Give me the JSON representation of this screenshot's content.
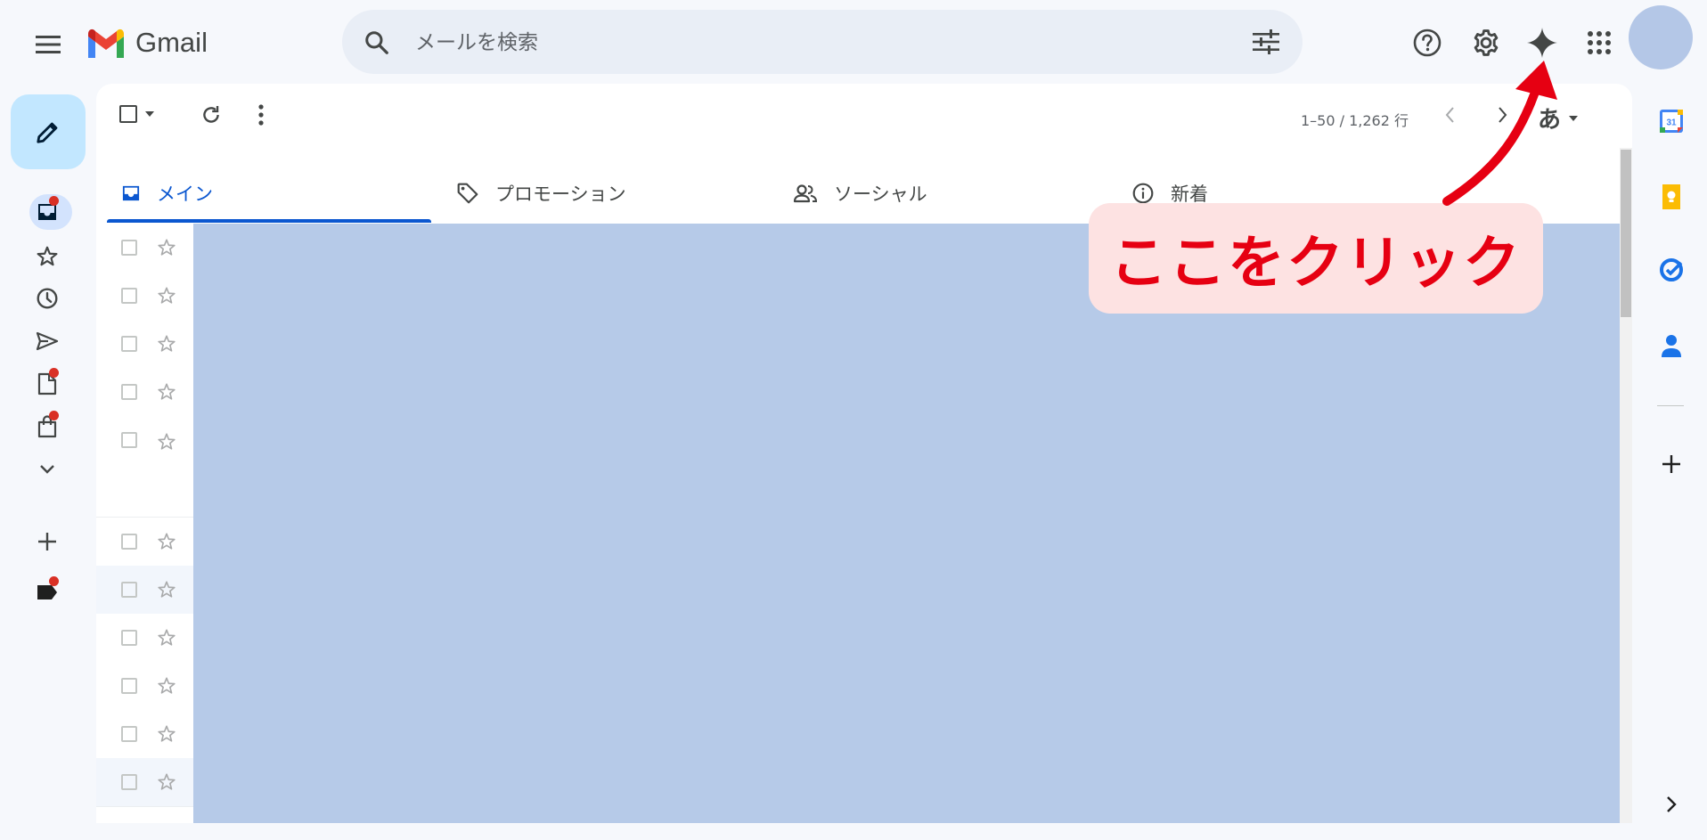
{
  "app": {
    "name": "Gmail"
  },
  "header": {
    "search_placeholder": "メールを検索"
  },
  "toolbar": {
    "pagination": "1–50 / 1,262 行",
    "input_tool_label": "あ"
  },
  "tabs": [
    {
      "label": "メイン",
      "icon": "inbox-icon",
      "selected": true
    },
    {
      "label": "プロモーション",
      "icon": "tag-icon",
      "selected": false
    },
    {
      "label": "ソーシャル",
      "icon": "people-icon",
      "selected": false
    },
    {
      "label": "新着",
      "icon": "info-icon",
      "selected": false
    }
  ],
  "left_nav": [
    {
      "icon": "inbox-icon",
      "active": true,
      "badge": true
    },
    {
      "icon": "star-icon",
      "badge": false
    },
    {
      "icon": "clock-icon",
      "badge": false
    },
    {
      "icon": "send-icon",
      "badge": false
    },
    {
      "icon": "draft-icon",
      "badge": true
    },
    {
      "icon": "shopping-bag-icon",
      "badge": true
    },
    {
      "icon": "chevron-down-icon",
      "badge": false
    },
    {
      "icon": "plus-icon",
      "badge": false
    },
    {
      "icon": "label-icon",
      "badge": true
    }
  ],
  "side_panel": [
    {
      "icon": "calendar-icon",
      "text": "31"
    },
    {
      "icon": "keep-icon"
    },
    {
      "icon": "tasks-icon"
    },
    {
      "icon": "contacts-icon"
    },
    {
      "icon": "plus-icon"
    },
    {
      "icon": "chevron-right-icon"
    }
  ],
  "annotation": {
    "text": "ここをクリック",
    "color": "#e60012",
    "background": "#fde2e2"
  },
  "colors": {
    "accent": "#0b57d0",
    "compose_bg": "#c2e7ff",
    "highlight": "#b6cae8",
    "page_bg": "#f6f8fc"
  }
}
